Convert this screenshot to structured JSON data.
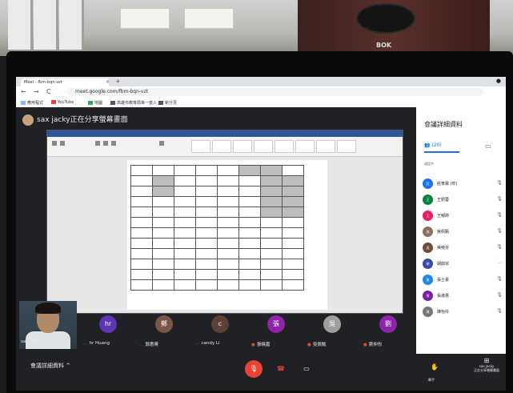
{
  "browser": {
    "tab_title": "Meet - fbm-bqn-vzt",
    "tab_close": "×",
    "new_tab": "+",
    "window_close": "●",
    "nav_back": "←",
    "nav_forward": "→",
    "nav_reload": "C",
    "url": "meet.google.com/fbm-bqn-vzt",
    "bookmarks": [
      "應用程式",
      "YouTube",
      "地圖",
      "高雄市教育局單一簽入",
      "新分頁"
    ],
    "monitor_brand": "BOK"
  },
  "meet": {
    "presenter_text": "sax jacky正在分享螢幕畫面",
    "side_title": "會議詳細資料",
    "people_count": "(20)",
    "side_subtitle": "通話中",
    "participants": [
      {
        "initial": "莊",
        "name": "莊育霖 (你)",
        "color": "#1a73e8"
      },
      {
        "initial": "王",
        "name": "王妍蓉",
        "color": "#0b8043"
      },
      {
        "initial": "王",
        "name": "王郁婷",
        "color": "#e91e63"
      },
      {
        "initial": "吳",
        "name": "吳佩甄",
        "color": "#8d6e63"
      },
      {
        "initial": "吳",
        "name": "吳曉芬",
        "color": "#6d4c41"
      },
      {
        "initial": "胡",
        "name": "胡鼎宗",
        "color": "#3949ab"
      },
      {
        "initial": "張",
        "name": "張士豪",
        "color": "#1e88e5"
      },
      {
        "initial": "張",
        "name": "張淑惠",
        "color": "#7b1fa2"
      },
      {
        "initial": "陳",
        "name": "陳怡伶",
        "color": "#757575"
      }
    ],
    "tiles": [
      {
        "initial": "hr",
        "name": "hr Huang",
        "color": "#5e35b1",
        "marker": "…"
      },
      {
        "initial": "鄭",
        "name": "鄭惠菁",
        "color": "#795548",
        "marker": "…"
      },
      {
        "initial": "c",
        "name": "candy Li",
        "color": "#5d4037",
        "marker": "…"
      },
      {
        "initial": "張",
        "name": "張曉嘉",
        "color": "#8e24aa",
        "marker": "●"
      },
      {
        "initial": "吳",
        "name": "吳佩甄",
        "color": "#9e9e9e",
        "marker": "●"
      },
      {
        "initial": "劉",
        "name": "劉仲彤",
        "color": "#8e24aa",
        "marker": "●"
      }
    ],
    "self_label": "sax jacky",
    "details_button": "會議詳細資料  ^",
    "raise_hand": "舉手",
    "presenting_name": "sax jacky",
    "presenting_label": "正在分享螢幕畫面",
    "icons": {
      "mic_off": "mic-off-icon",
      "hang_up": "hang-up-icon",
      "camera": "camera-icon",
      "hand": "hand-icon",
      "people": "people-icon",
      "chat": "chat-icon"
    }
  }
}
